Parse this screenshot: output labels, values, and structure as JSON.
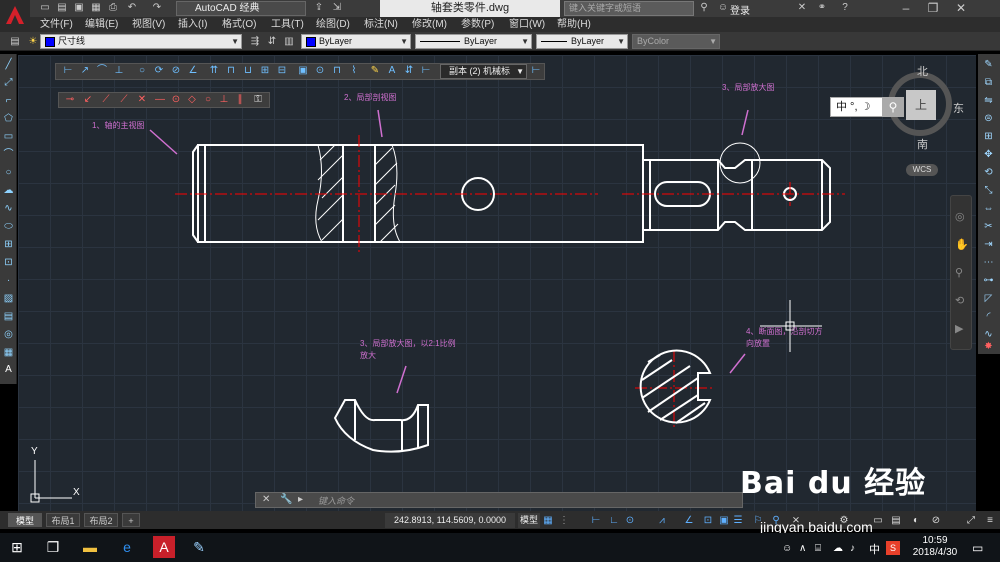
{
  "window": {
    "doc_title": "轴套类零件.dwg",
    "workspace": "AutoCAD 经典",
    "search_placeholder": "键入关键字或短语",
    "login": "登录"
  },
  "menu": [
    "文件(F)",
    "编辑(E)",
    "视图(V)",
    "插入(I)",
    "格式(O)",
    "工具(T)",
    "绘图(D)",
    "标注(N)",
    "修改(M)",
    "参数(P)",
    "窗口(W)",
    "帮助(H)"
  ],
  "properties": {
    "layer": "尺寸线",
    "color": "ByLayer",
    "linetype": "ByLayer",
    "lineweight": "ByLayer",
    "plotstyle": "ByColor",
    "color_swatch": "#0000ff"
  },
  "dim_style": "副本 (2) 机械标",
  "viewcube": {
    "north": "北",
    "south": "南",
    "east": "东",
    "face": "上",
    "wcs": "WCS"
  },
  "ime": {
    "label": "中 °, ☽"
  },
  "annotations": {
    "a1": "1、轴的主视图",
    "a2": "2、局部剖视图",
    "a3": "3、局部放大图",
    "a4_line1": "3、局部放大图，以2:1比例",
    "a4_line2": "放大",
    "a5_line1": "4、断面图，沿剖切方",
    "a5_line2": "向放置"
  },
  "axes": {
    "y": "Y",
    "x": "X"
  },
  "command": {
    "placeholder": "键入命令"
  },
  "tabs": [
    "模型",
    "布局1",
    "布局2",
    "+"
  ],
  "status": {
    "coords": "242.8913, 114.5609, 0.0000",
    "model": "模型"
  },
  "taskbar": {
    "time": "10:59",
    "date": "2018/4/30",
    "ime": "中"
  },
  "watermark": {
    "logo": "Bai du 经验",
    "url": "jingyan.baidu.com"
  },
  "colors": {
    "accent": "#d070d0",
    "centerline": "#ff0000",
    "canvas": "#212830"
  }
}
